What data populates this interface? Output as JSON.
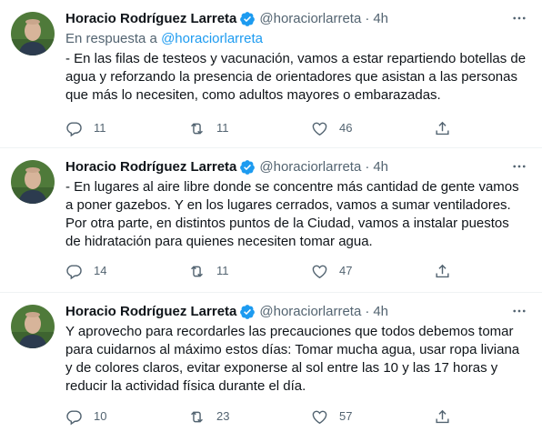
{
  "tweets": [
    {
      "name": "Horacio Rodríguez Larreta",
      "handle": "@horaciorlarreta",
      "separator": "·",
      "time": "4h",
      "reply_prefix": "En respuesta a",
      "reply_handle": "@horaciorlarreta",
      "text": "- En las filas de testeos y vacunación, vamos a estar repartiendo botellas de agua y reforzando la presencia de orientadores que asistan a las personas que más lo necesiten, como adultos mayores o embarazadas.",
      "replies": "11",
      "retweets": "11",
      "likes": "46"
    },
    {
      "name": "Horacio Rodríguez Larreta",
      "handle": "@horaciorlarreta",
      "separator": "·",
      "time": "4h",
      "text": "- En lugares al aire libre donde se concentre más cantidad de gente vamos a poner gazebos. Y en los lugares cerrados, vamos a sumar ventiladores. Por otra parte, en distintos puntos de la Ciudad, vamos a instalar puestos de hidratación para quienes necesiten tomar agua.",
      "replies": "14",
      "retweets": "11",
      "likes": "47"
    },
    {
      "name": "Horacio Rodríguez Larreta",
      "handle": "@horaciorlarreta",
      "separator": "·",
      "time": "4h",
      "text": "Y aprovecho para recordarles las precauciones que todos debemos tomar para cuidarnos al máximo estos días: Tomar mucha agua, usar ropa liviana y de colores claros, evitar exponerse al sol entre las 10 y las 17 horas y reducir la actividad física durante el día.",
      "replies": "10",
      "retweets": "23",
      "likes": "57"
    }
  ],
  "icons": {
    "verified": "verified-badge-icon",
    "more": "more-options-icon",
    "reply": "reply-icon",
    "retweet": "retweet-icon",
    "like": "like-icon",
    "share": "share-icon"
  },
  "colors": {
    "text": "#0f1419",
    "secondary": "#536471",
    "accent": "#1d9bf0",
    "divider": "#eff3f4"
  }
}
